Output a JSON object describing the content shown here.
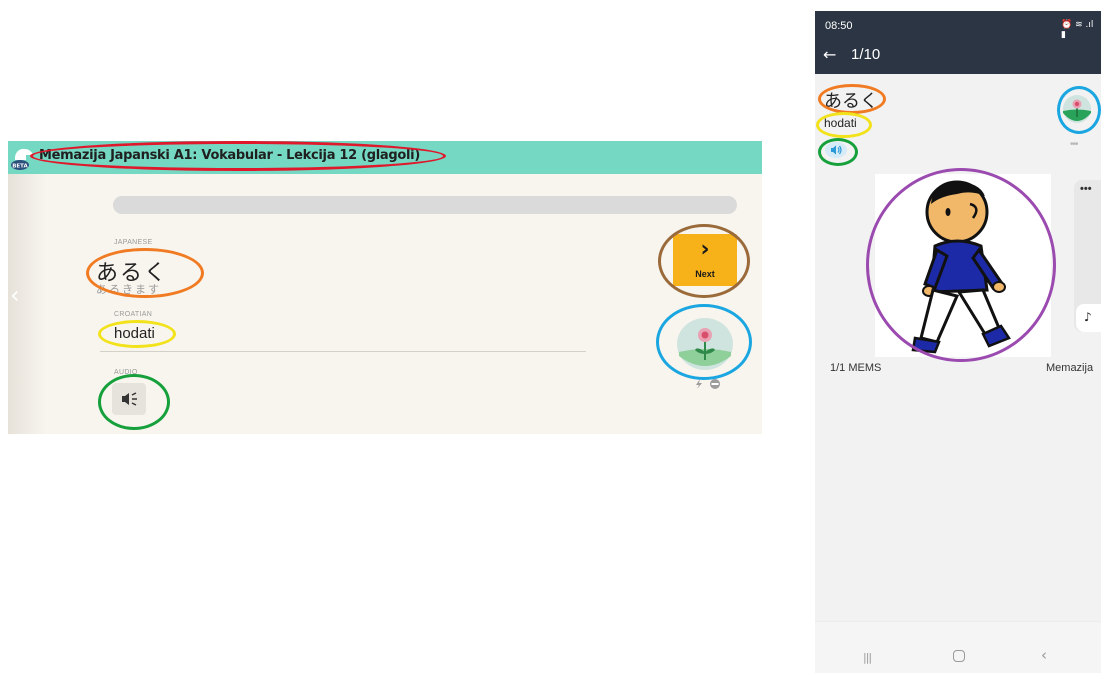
{
  "desktop": {
    "title": "Memazija Japanski A1: Vokabular - Lekcija 12 (glagoli)",
    "beta_badge": "BETA",
    "prev_arrow": "‹",
    "labels": {
      "japanese": "JAPANESE",
      "croatian": "CROATIAN",
      "audio": "AUDIO"
    },
    "japanese_word": "あるく",
    "japanese_reading": "あるきます",
    "croatian_word": "hodati",
    "next_label": "Next",
    "next_icon": "chevron-right-icon",
    "audio_icon": "speaker-icon",
    "mem_icon": "flower-icon"
  },
  "phone": {
    "time": "08:50",
    "status_icons": "⏰ ≋ .ıl ▮",
    "back_icon": "←",
    "progress": "1/10",
    "japanese_word": "あるく",
    "croatian_word": "hodati",
    "more_dots": "•••",
    "scroll_dots": "•••",
    "scroll_note": "♪",
    "mems_count": "1/1 MEMS",
    "brand": "Memazija",
    "nav": {
      "recent": "|||",
      "back": "‹"
    }
  },
  "colors": {
    "header_teal": "#75d8c3",
    "next_orange": "#f7b21a",
    "phone_topbar": "#2c3544",
    "annotation_red": "#e0182c",
    "annotation_orange": "#f07b22",
    "annotation_yellow": "#f2e21b",
    "annotation_green": "#16a03c",
    "annotation_brown": "#9a6a3a",
    "annotation_blue": "#1aa6e0",
    "annotation_purple": "#9b4ab0"
  }
}
